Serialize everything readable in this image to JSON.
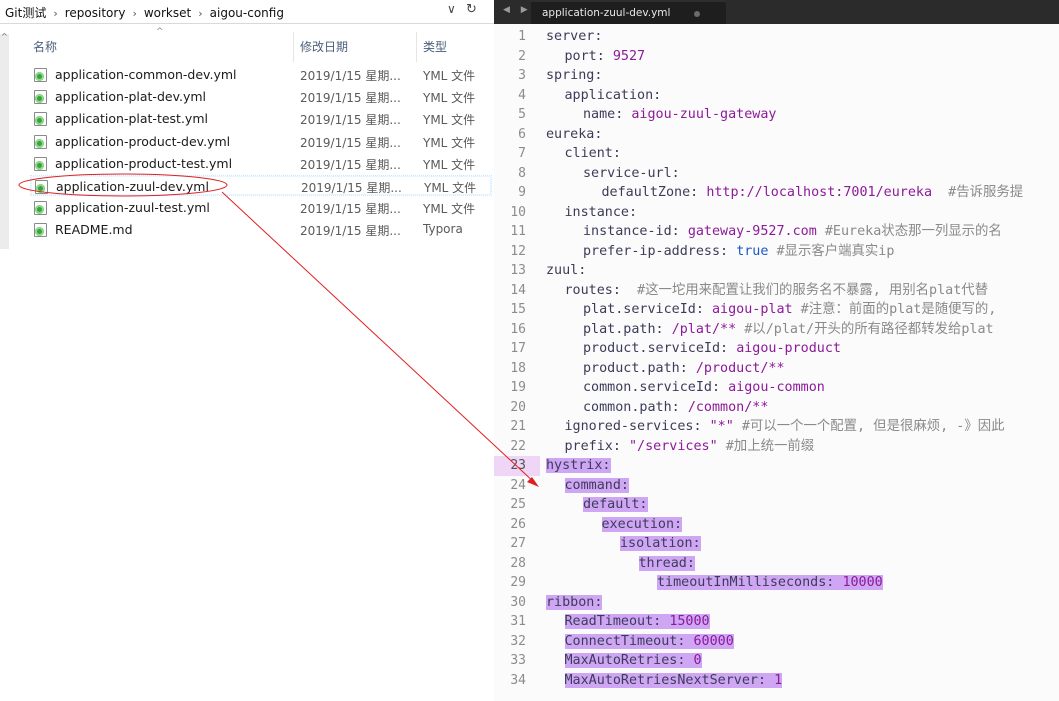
{
  "explorer": {
    "breadcrumb": [
      "Git测试",
      "repository",
      "workset",
      "aigou-config"
    ],
    "dropdown_icon": "chevron-down-icon",
    "refresh_icon": "refresh-icon",
    "columns": {
      "name": "名称",
      "date": "修改日期",
      "type": "类型"
    },
    "files": [
      {
        "name": "application-common-dev.yml",
        "date": "2019/1/15 星期...",
        "type": "YML 文件"
      },
      {
        "name": "application-plat-dev.yml",
        "date": "2019/1/15 星期...",
        "type": "YML 文件"
      },
      {
        "name": "application-plat-test.yml",
        "date": "2019/1/15 星期...",
        "type": "YML 文件"
      },
      {
        "name": "application-product-dev.yml",
        "date": "2019/1/15 星期...",
        "type": "YML 文件"
      },
      {
        "name": "application-product-test.yml",
        "date": "2019/1/15 星期...",
        "type": "YML 文件"
      },
      {
        "name": "application-zuul-dev.yml",
        "date": "2019/1/15 星期...",
        "type": "YML 文件"
      },
      {
        "name": "application-zuul-test.yml",
        "date": "2019/1/15 星期...",
        "type": "YML 文件"
      },
      {
        "name": "README.md",
        "date": "2019/1/15 星期...",
        "type": "Typora"
      }
    ],
    "selected_file": "application-zuul-dev.yml",
    "annotation_color": "#e02020"
  },
  "editor": {
    "tab_title": "application-zuul-dev.yml",
    "highlight_color": "#cfa6f4",
    "current_line": 23,
    "lines": [
      {
        "n": "1",
        "indent": 0,
        "segs": [
          [
            "k",
            "server:"
          ]
        ]
      },
      {
        "n": "2",
        "indent": 1,
        "segs": [
          [
            "k",
            "port: "
          ],
          [
            "v",
            "9527"
          ]
        ]
      },
      {
        "n": "3",
        "indent": 0,
        "segs": [
          [
            "k",
            "spring:"
          ]
        ]
      },
      {
        "n": "4",
        "indent": 1,
        "segs": [
          [
            "k",
            "application:"
          ]
        ]
      },
      {
        "n": "5",
        "indent": 2,
        "segs": [
          [
            "k",
            "name: "
          ],
          [
            "v",
            "aigou-zuul-gateway"
          ]
        ]
      },
      {
        "n": "6",
        "indent": 0,
        "segs": [
          [
            "k",
            "eureka:"
          ]
        ]
      },
      {
        "n": "7",
        "indent": 1,
        "segs": [
          [
            "k",
            "client:"
          ]
        ]
      },
      {
        "n": "8",
        "indent": 2,
        "segs": [
          [
            "k",
            "service-url:"
          ]
        ]
      },
      {
        "n": "9",
        "indent": 3,
        "segs": [
          [
            "k",
            "defaultZone: "
          ],
          [
            "v",
            "http://localhost:7001/eureka"
          ],
          [
            "cm",
            "  #告诉服务提"
          ]
        ]
      },
      {
        "n": "10",
        "indent": 1,
        "segs": [
          [
            "k",
            "instance:"
          ]
        ]
      },
      {
        "n": "11",
        "indent": 2,
        "segs": [
          [
            "k",
            "instance-id: "
          ],
          [
            "v",
            "gateway-9527.com"
          ],
          [
            "cm",
            " #Eureka状态那一列显示的名"
          ]
        ]
      },
      {
        "n": "12",
        "indent": 2,
        "segs": [
          [
            "k",
            "prefer-ip-address: "
          ],
          [
            "b",
            "true"
          ],
          [
            "cm",
            " #显示客户端真实ip"
          ]
        ]
      },
      {
        "n": "13",
        "indent": 0,
        "segs": [
          [
            "k",
            "zuul:"
          ]
        ]
      },
      {
        "n": "14",
        "indent": 1,
        "segs": [
          [
            "k",
            "routes: "
          ],
          [
            "cm",
            " #这一坨用来配置让我们的服务名不暴露, 用别名plat代替"
          ]
        ]
      },
      {
        "n": "15",
        "indent": 2,
        "segs": [
          [
            "k",
            "plat.serviceId: "
          ],
          [
            "v",
            "aigou-plat"
          ],
          [
            "cm",
            " #注意：前面的plat是随便写的,"
          ]
        ]
      },
      {
        "n": "16",
        "indent": 2,
        "segs": [
          [
            "k",
            "plat.path: "
          ],
          [
            "v",
            "/plat/**"
          ],
          [
            "cm",
            " #以/plat/开头的所有路径都转发给plat"
          ]
        ]
      },
      {
        "n": "17",
        "indent": 2,
        "segs": [
          [
            "k",
            "product.serviceId: "
          ],
          [
            "v",
            "aigou-product"
          ]
        ]
      },
      {
        "n": "18",
        "indent": 2,
        "segs": [
          [
            "k",
            "product.path: "
          ],
          [
            "v",
            "/product/**"
          ]
        ]
      },
      {
        "n": "19",
        "indent": 2,
        "segs": [
          [
            "k",
            "common.serviceId: "
          ],
          [
            "v",
            "aigou-common"
          ]
        ]
      },
      {
        "n": "20",
        "indent": 2,
        "segs": [
          [
            "k",
            "common.path: "
          ],
          [
            "v",
            "/common/**"
          ]
        ]
      },
      {
        "n": "21",
        "indent": 1,
        "segs": [
          [
            "k",
            "ignored-services: "
          ],
          [
            "s",
            "\"*\""
          ],
          [
            "cm",
            " #可以一个一个配置, 但是很麻烦, -》因此"
          ]
        ]
      },
      {
        "n": "22",
        "indent": 1,
        "segs": [
          [
            "k",
            "prefix: "
          ],
          [
            "s",
            "\"/services\""
          ],
          [
            "cm",
            " #加上统一前缀"
          ]
        ]
      },
      {
        "n": "23",
        "indent": 0,
        "hl": true,
        "segs": [
          [
            "k",
            "hystrix:"
          ]
        ]
      },
      {
        "n": "24",
        "indent": 1,
        "hl": true,
        "segs": [
          [
            "k",
            "command:"
          ]
        ]
      },
      {
        "n": "25",
        "indent": 2,
        "hl": true,
        "segs": [
          [
            "k",
            "default:"
          ]
        ]
      },
      {
        "n": "26",
        "indent": 3,
        "hl": true,
        "segs": [
          [
            "k",
            "execution:"
          ]
        ]
      },
      {
        "n": "27",
        "indent": 4,
        "hl": true,
        "segs": [
          [
            "k",
            "isolation:"
          ]
        ]
      },
      {
        "n": "28",
        "indent": 5,
        "hl": true,
        "segs": [
          [
            "k",
            "thread:"
          ]
        ]
      },
      {
        "n": "29",
        "indent": 6,
        "hl": true,
        "segs": [
          [
            "k",
            "timeoutInMilliseconds: "
          ],
          [
            "v",
            "10000"
          ]
        ]
      },
      {
        "n": "30",
        "indent": 0,
        "hl": true,
        "segs": [
          [
            "k",
            "ribbon:"
          ]
        ]
      },
      {
        "n": "31",
        "indent": 1,
        "hl": true,
        "segs": [
          [
            "k",
            "ReadTimeout: "
          ],
          [
            "v",
            "15000"
          ]
        ]
      },
      {
        "n": "32",
        "indent": 1,
        "hl": true,
        "segs": [
          [
            "k",
            "ConnectTimeout: "
          ],
          [
            "v",
            "60000"
          ]
        ]
      },
      {
        "n": "33",
        "indent": 1,
        "hl": true,
        "segs": [
          [
            "k",
            "MaxAutoRetries: "
          ],
          [
            "v",
            "0"
          ]
        ]
      },
      {
        "n": "34",
        "indent": 1,
        "hl": true,
        "segs": [
          [
            "k",
            "MaxAutoRetriesNextServer: "
          ],
          [
            "v",
            "1"
          ]
        ]
      }
    ]
  }
}
